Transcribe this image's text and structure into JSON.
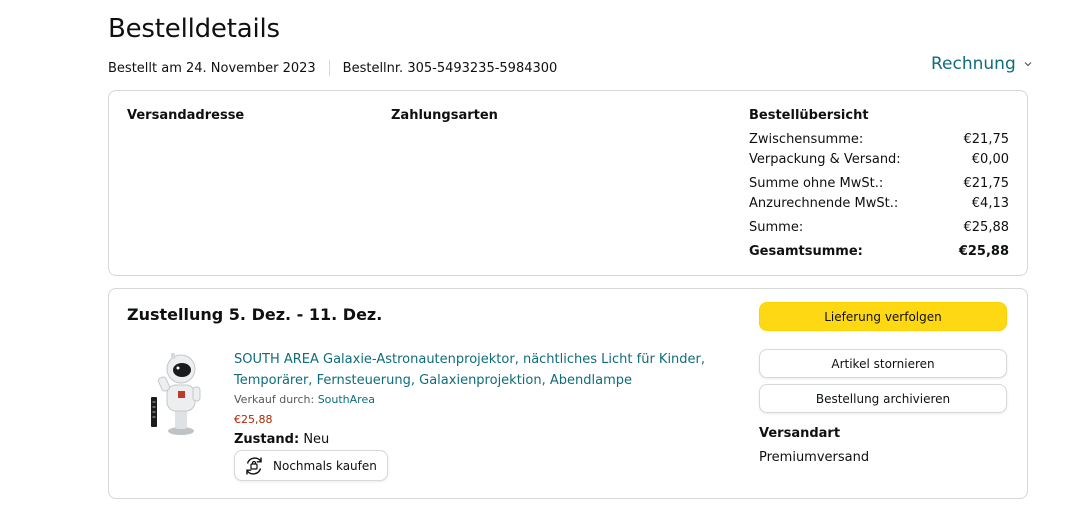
{
  "header": {
    "title": "Bestelldetails",
    "ordered_on": "Bestellt am 24. November 2023",
    "order_number": "Bestellnr. 305-5493235-5984300",
    "invoice_label": "Rechnung"
  },
  "overview": {
    "shipping_address_title": "Versandadresse",
    "payment_methods_title": "Zahlungsarten",
    "summary_title": "Bestellübersicht",
    "rows": [
      {
        "label": "Zwischensumme:",
        "value": "€21,75"
      },
      {
        "label": "Verpackung & Versand:",
        "value": "€0,00"
      },
      {
        "label": "Summe ohne MwSt.:",
        "value": "€21,75"
      },
      {
        "label": "Anzurechnende MwSt.:",
        "value": "€4,13"
      },
      {
        "label": "Summe:",
        "value": "€25,88"
      },
      {
        "label": "Gesamtsumme:",
        "value": "€25,88"
      }
    ]
  },
  "shipment": {
    "delivery_title": "Zustellung 5. Dez. - 11. Dez.",
    "product_title": "SOUTH AREA Galaxie-Astronautenprojektor, nächtliches Licht für Kinder, Temporärer, Fernsteuerung, Galaxienprojektion, Abendlampe",
    "seller_prefix": "Verkauf durch:",
    "seller_name": "SouthArea",
    "price": "€25,88",
    "condition_label": "Zustand:",
    "condition_value": "Neu",
    "buy_again_label": "Nochmals kaufen",
    "track_button": "Lieferung verfolgen",
    "cancel_button": "Artikel stornieren",
    "archive_button": "Bestellung archivieren",
    "shipping_type_title": "Versandart",
    "shipping_type_value": "Premiumversand"
  },
  "colors": {
    "link": "#0f6d7a",
    "price": "#b12704",
    "primary_button": "#ffd814",
    "border": "#d5d9d9"
  },
  "icons": [
    "chevron-down-icon",
    "buy-again-icon"
  ]
}
